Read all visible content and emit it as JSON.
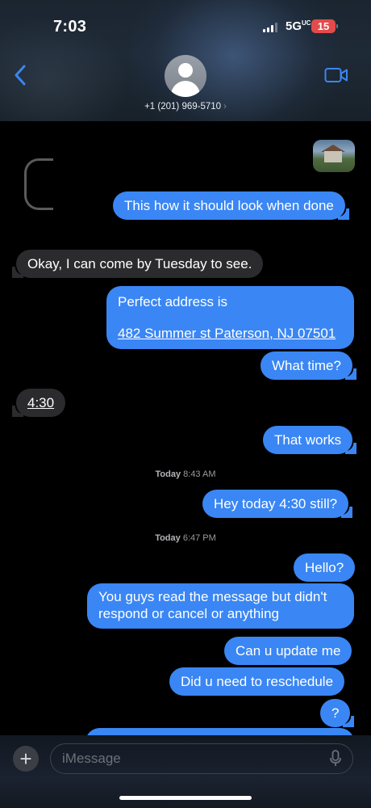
{
  "status_bar": {
    "time": "7:03",
    "network": "5G",
    "network_suffix": "UC",
    "battery": "15"
  },
  "header": {
    "contact": "+1 (201) 969-5710",
    "chevron": "›",
    "back_icon": "chevron-left-icon",
    "video_icon": "video-camera-icon"
  },
  "thread": {
    "messages": [
      {
        "dir": "out",
        "text": "This how it should look when done"
      },
      {
        "dir": "in",
        "text": "Okay, I can come by Tuesday to see."
      },
      {
        "dir": "out",
        "line1": "Perfect address is",
        "line2": "482 Summer st Paterson, NJ 07501"
      },
      {
        "dir": "out",
        "text": "What time?"
      },
      {
        "dir": "in",
        "text": "4:30"
      },
      {
        "dir": "out",
        "text": "That works"
      },
      {
        "dir": "out",
        "text": "Hey today 4:30 still?"
      },
      {
        "dir": "out",
        "text": "Hello?"
      },
      {
        "dir": "out",
        "line1": "You guys read the message but didn't",
        "line2": "respond or cancel or anything"
      },
      {
        "dir": "out",
        "text": "Can u update me"
      },
      {
        "dir": "out",
        "text": "Did u need to reschedule"
      },
      {
        "dir": "out",
        "text": "?"
      }
    ],
    "timestamps": [
      {
        "day": "Today",
        "time": "8:43 AM"
      },
      {
        "day": "Today",
        "time": "6:47 PM"
      }
    ]
  },
  "composer": {
    "placeholder": "iMessage",
    "plus_label": "+",
    "mic_icon": "microphone-icon"
  },
  "colors": {
    "outgoing": "#3a86f4",
    "incoming": "#2b2b2e",
    "accent": "#3a86f4"
  }
}
